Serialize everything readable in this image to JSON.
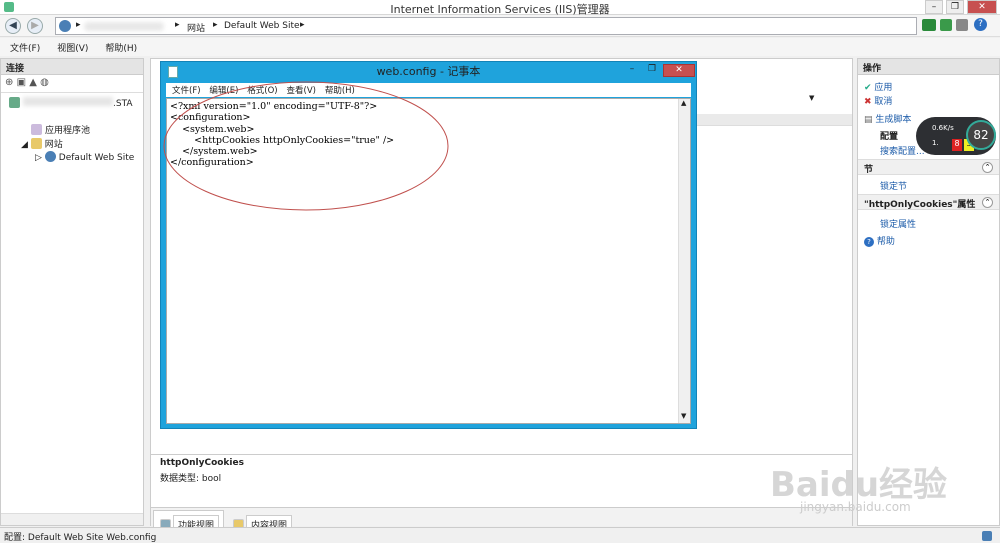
{
  "window": {
    "title": "Internet Information Services (IIS)管理器"
  },
  "address": {
    "segments": [
      "网站",
      "Default Web Site"
    ]
  },
  "menu": {
    "items": [
      "文件(F)",
      "视图(V)",
      "帮助(H)"
    ]
  },
  "connections": {
    "title": "连接",
    "tree": [
      "应用程序池",
      "网站",
      "Default Web Site"
    ],
    "blurred_suffix": ".STA"
  },
  "center": {
    "info_title": "httpOnlyCookies",
    "info_type": "数据类型: bool",
    "tabs": [
      "功能视图",
      "内容视图"
    ]
  },
  "notepad": {
    "title": "web.config - 记事本",
    "menu": [
      "文件(F)",
      "编辑(E)",
      "格式(O)",
      "查看(V)",
      "帮助(H)"
    ],
    "content": "<?xml version=\"1.0\" encoding=\"UTF-8\"?>\n<configuration>\n    <system.web>\n        <httpCookies httpOnlyCookies=\"true\" />\n    </system.web>\n</configuration>"
  },
  "actions": {
    "title": "操作",
    "apply": "应用",
    "cancel": "取消",
    "gen_script": "生成脚本",
    "config": "配置",
    "search_config": "搜索配置...",
    "section_title": "节",
    "lock_section": "锁定节",
    "prop_section_title": "\"httpOnlyCookies\"属性",
    "lock_attr": "锁定属性",
    "help": "帮助"
  },
  "widget": {
    "speed1": "0.6K/s",
    "speed2": "1.",
    "percent": "82",
    "badge1": "8",
    "badge2": "3"
  },
  "statusbar": {
    "text": "配置: Default Web Site Web.config"
  },
  "watermark": {
    "brand": "Baidu经验",
    "url": "jingyan.baidu.com"
  },
  "colors": {
    "accent": "#1fa3dc",
    "link": "#1a5aa8",
    "annotation": "#c0504d"
  }
}
